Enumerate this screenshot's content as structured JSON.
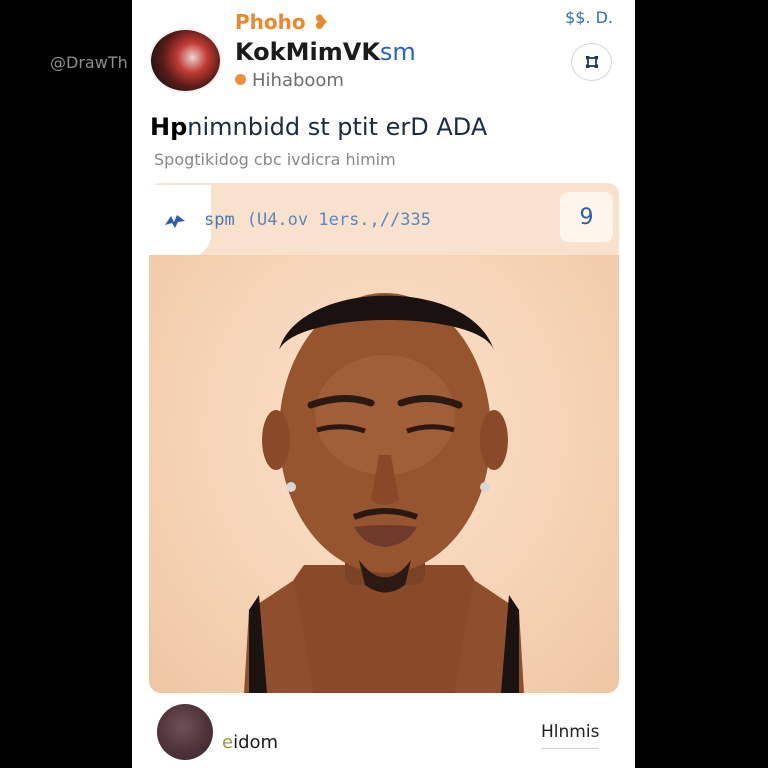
{
  "watermark": "@DrawTh  weets",
  "header": {
    "brand": "Phoho",
    "brand_icon": "❥",
    "corner_text": "$$. D.",
    "username_bold": "KokMimVK",
    "username_rest": "sm",
    "handle": "Hihaboom",
    "menu_icon": "expand-icon"
  },
  "post": {
    "headline_bold": "Hp",
    "headline_rest": "nimnbidd st ptit erD ADA",
    "subline": "Spogtikidog cbc ivdicra himim",
    "time": "spm",
    "date": "(U4.ov 1ers.,//335",
    "count": "9"
  },
  "footer": {
    "label_mark": "e",
    "label_rest": "idom",
    "link": "Hlnmis"
  },
  "colors": {
    "accent": "#2563c0",
    "brand": "#e8892b",
    "card_bg": "#f7d8bd"
  }
}
